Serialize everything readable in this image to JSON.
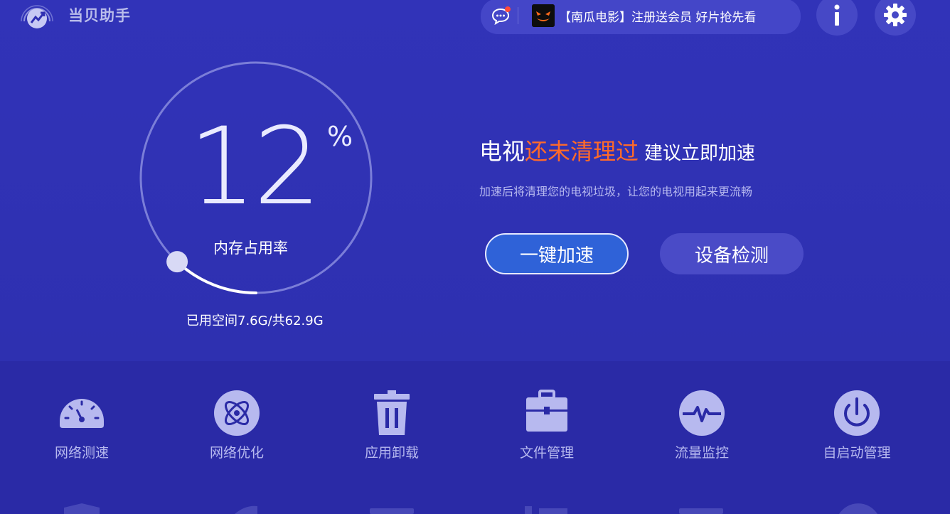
{
  "header": {
    "app_title": "当贝助手",
    "promo_text": "【南瓜电影】注册送会员 好片抢先看",
    "info_label": "i"
  },
  "gauge": {
    "value": "12",
    "unit": "%",
    "label": "内存占用率",
    "storage_text": "已用空间7.6G/共62.9G",
    "fraction": 0.12
  },
  "status": {
    "prefix": "电视",
    "highlight": "还未清理过",
    "suffix": "建议立即加速",
    "subtitle": "加速后将清理您的电视垃圾，让您的电视用起来更流畅",
    "speedup_label": "一键加速",
    "detect_label": "设备检测"
  },
  "tools": [
    {
      "label": "网络测速",
      "icon": "speedometer-icon"
    },
    {
      "label": "网络优化",
      "icon": "atom-icon"
    },
    {
      "label": "应用卸载",
      "icon": "trash-icon"
    },
    {
      "label": "文件管理",
      "icon": "briefcase-icon"
    },
    {
      "label": "流量监控",
      "icon": "pulse-icon"
    },
    {
      "label": "自启动管理",
      "icon": "power-icon"
    }
  ],
  "colors": {
    "background": "#2f2fb2",
    "accent_orange": "#ff6a2a",
    "primary_button": "#2f62d8",
    "secondary_button": "#4a4bc7",
    "icon_color": "#b7b9ef"
  }
}
